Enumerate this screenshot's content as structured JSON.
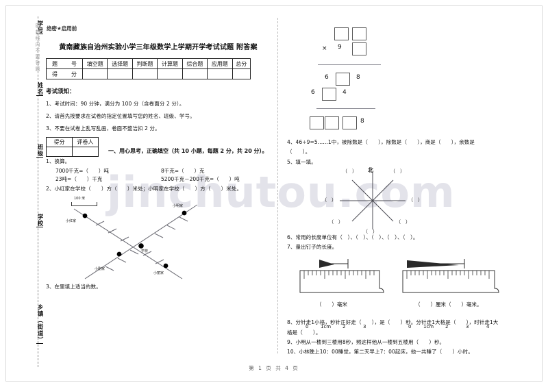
{
  "page": {
    "secret_mark": "绝密★启用前",
    "title": "黄南藏族自治州实验小学三年级数学上学期开学考试试题 附答案",
    "watermark": "jinchutou.com",
    "footer": "第 1 页 共 4 页"
  },
  "seal_margin": {
    "labels": [
      "学号",
      "姓名",
      "班级",
      "学校",
      "乡镇（街道）"
    ],
    "faint_text": "密封线内不要答题"
  },
  "score_table": {
    "row1_lead": "题　号",
    "row2_lead": "得　分",
    "columns": [
      "填空题",
      "选择题",
      "判断题",
      "计算题",
      "综合题",
      "应用题",
      "总分"
    ],
    "values": [
      "",
      "",
      "",
      "",
      "",
      "",
      ""
    ]
  },
  "notice": {
    "heading": "考试须知：",
    "items": [
      "1、考试时间：90 分钟，满分为 100 分（含卷面分 2 分）。",
      "2、请首先按要求在试卷的指定位置填写您的姓名、班级、学号。",
      "3、不要在试卷上乱写乱画，卷面不整洁扣 2 分。"
    ]
  },
  "grader_box": {
    "score_label": "得分",
    "marker_label": "评卷人"
  },
  "section_one": {
    "title": "一、用心思考，正确填空（共 10 小题，每题 2 分，共 20 分）。"
  },
  "questions": {
    "q1": {
      "stem": "1、换算。",
      "a": "7000千克=（　　）吨",
      "b": "23吨=（　　）千克",
      "c": "8千克=（　　）克",
      "d": "5200千克－200千克=（　　）吨"
    },
    "q2": {
      "stem": "2、小红家在学校（　　）方（　　）米处；小明家在学校（　　）方（　　）米处。"
    },
    "q3": {
      "stem": "3、在里填上适当的数。"
    },
    "q4": {
      "stem": "4、46÷9=5……1中，被除数是（　　），除数是（　　），商是（　　），余数是",
      "cont": "（　　）。"
    },
    "q5": {
      "stem": "5、填一填。"
    },
    "q6": {
      "stem": "6、常用的长度单位有（　）、（　）、（　）、（　）、（　）。"
    },
    "q7": {
      "stem": "7、量出钉子的长度。"
    },
    "q8": {
      "stem": "8、分针走1小格，秒针正好走（　　），是（　　）秒。分针走1大格是（　　），时针走1大",
      "cont": "格是（　　）。"
    },
    "q9": {
      "stem": "9、小明从一楼到三楼用8秒，照这样他从一楼到五楼用（　　）秒。"
    },
    "q10": {
      "stem": "10、小林晚上10：00睡觉，第二天早上7：00起床，他一共睡了（　　）小时。"
    }
  },
  "map_figure": {
    "scale_label": "100 米",
    "labels": {
      "xiaohong": "小红家",
      "xiaoming": "小明家",
      "xuexiao": "学校",
      "xiaogang": "小刚家",
      "xiaoli": "小丽家"
    }
  },
  "vertical_multiplication": {
    "operator": "×",
    "multiplier_digit": "9",
    "row1_boxes": [
      "",
      "",
      ""
    ],
    "partial1": {
      "left": "6",
      "box": "",
      "right": "8"
    },
    "partial2": {
      "left": "6",
      "box": "",
      "right": "4"
    },
    "result": {
      "boxes": [
        "",
        "",
        ""
      ],
      "last_digit": "8"
    }
  },
  "compass": {
    "north": "北",
    "blanks": [
      "（　）",
      "（　）",
      "（　）",
      "（　）",
      "（　）",
      "（　）",
      "（　）"
    ]
  },
  "rulers": {
    "left": {
      "ticks": [
        "0",
        "1cm",
        "2",
        "3"
      ],
      "answer": "（　　）毫米"
    },
    "right": {
      "ticks": [
        "0",
        "1cm",
        "2",
        "3",
        "4"
      ],
      "answer": "（　　）厘米（　　）毫米。"
    }
  },
  "colors": {
    "ink": "#111111",
    "rule": "#8a8a93",
    "watermark": "#e3e3ea",
    "border": "#222222"
  }
}
